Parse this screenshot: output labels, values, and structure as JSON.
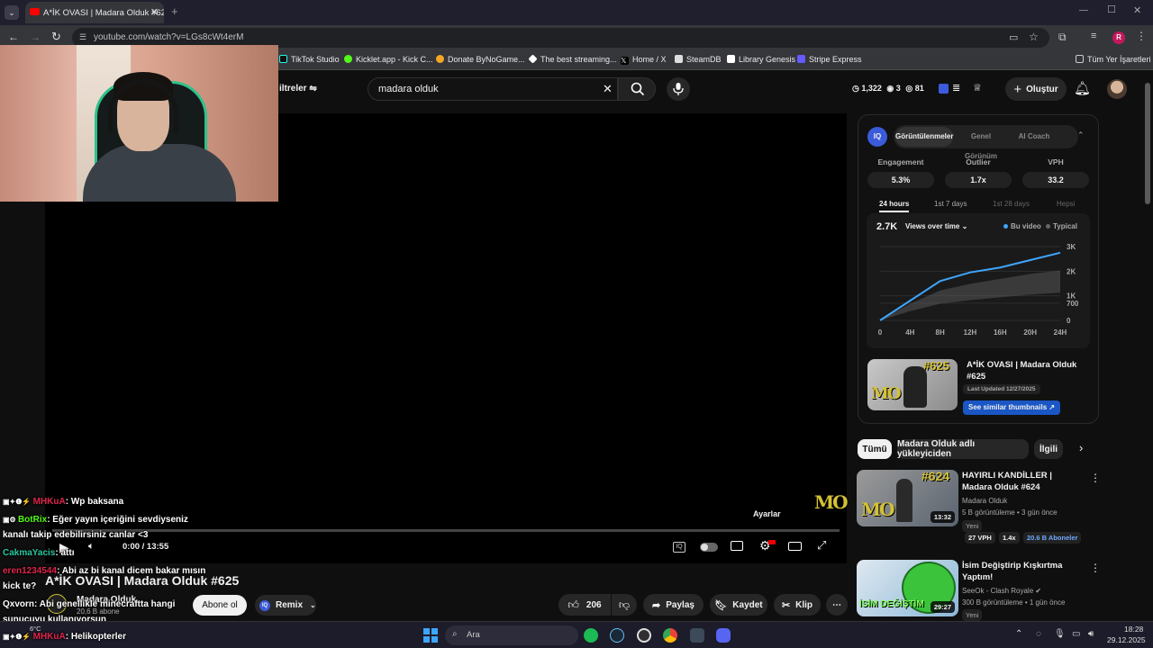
{
  "browser": {
    "tab_title": "A*İK OVASI | Madara Olduk #62",
    "url": "youtube.com/watch?v=LGs8cWt4erM",
    "bookmarks": [
      "TikTok Studio",
      "Kicklet.app - Kick C...",
      "Donate ByNoGame...",
      "The best streaming...",
      "Home / X",
      "SteamDB",
      "Library Genesis",
      "Stripe Express"
    ],
    "all_bookmarks": "Tüm Yer İşaretleri",
    "profile_initial": "R"
  },
  "youtube": {
    "filters_label": "iltreler",
    "search_value": "madara olduk",
    "stats": {
      "a": "1,322",
      "b": "3",
      "c": "81"
    },
    "create_label": "Oluştur"
  },
  "player": {
    "time": "0:00 / 13:55",
    "tooltip": "Ayarlar",
    "watermark": "MO"
  },
  "video": {
    "title": "A*İK OVASI | Madara Olduk #625",
    "channel": "Madara Olduk",
    "subscribers": "20,6 B abone",
    "subscribe_label": "Abone ol",
    "remix_label": "Remix",
    "likes": "206",
    "share_label": "Paylaş",
    "save_label": "Kaydet",
    "clip_label": "Klip"
  },
  "iq_panel": {
    "logo": "IQ",
    "tabs": [
      "Görüntülenmeler",
      "Genel Görünüm",
      "AI Coach"
    ],
    "metrics": [
      {
        "label": "Engagement",
        "value": "5.3%"
      },
      {
        "label": "Outlier",
        "value": "1.7x"
      },
      {
        "label": "VPH",
        "value": "33.2"
      }
    ],
    "time_tabs": [
      "24 hours",
      "1st 7 days",
      "1st 28 days",
      "Hepsi"
    ],
    "views_total": "2.7K",
    "views_selector": "Views over time",
    "legend": [
      "Bu video",
      "Typical"
    ],
    "thumb_title": "A*İK OVASI | Madara Olduk #625",
    "last_updated": "Last Updated 12/27/2025",
    "similar_label": "See similar thumbnails",
    "thumb_overlay": "#625",
    "thumb_logo": "MO"
  },
  "chart_data": {
    "type": "line",
    "x": [
      "0",
      "4H",
      "8H",
      "12H",
      "16H",
      "20H",
      "24H"
    ],
    "series": [
      {
        "name": "Bu video",
        "values": [
          0,
          800,
          1600,
          1950,
          2150,
          2450,
          2750
        ]
      },
      {
        "name": "Typical",
        "values": [
          0,
          500,
          900,
          1100,
          1250,
          1400,
          1500
        ]
      }
    ],
    "y_ticks": [
      "3K",
      "2K",
      "1K",
      "700",
      "0"
    ],
    "ylim": [
      0,
      3000
    ],
    "grid": true,
    "legend": "top-right"
  },
  "chips": [
    "Tümü",
    "Madara Olduk adlı yükleyiciden",
    "İlgili"
  ],
  "recommendations": [
    {
      "title": "HAYIRLI KANDİLLER | Madara Olduk #624",
      "channel": "Madara Olduk",
      "meta": "5 B görüntüleme • 3 gün önce",
      "tag": "Yeni",
      "duration": "13:32",
      "vph": "27 VPH",
      "outlier": "1.4x",
      "subs": "20.6 B Aboneler",
      "overlay": "#624",
      "logo": "MO"
    },
    {
      "title": "İsim Değiştirip Kışkırtma Yaptım!",
      "channel": "SeeOk - Clash Royale",
      "meta": "300 B görüntüleme • 1 gün önce",
      "tag": "Yeni",
      "duration": "29:27",
      "overlay": "İSİM DEĞİŞTİM"
    }
  ],
  "chat": [
    {
      "user": "MHKuA",
      "msg": ": Wp baksana",
      "color": "#e0244a"
    },
    {
      "user": "BotRix",
      "msg": ": Eğer yayın içeriğini sevdiyseniz",
      "color": "#53fc18"
    },
    {
      "user": "",
      "msg": "kanalı takip edebilirsiniz canlar <3",
      "color": "#ffffff"
    },
    {
      "user": "CakmaYacis",
      "msg": ": attı",
      "color": "#27c9a0"
    },
    {
      "user": "eren1234544",
      "msg": ": Abi az bi kanal dicem bakar mısın",
      "color": "#e0244a"
    },
    {
      "user": "",
      "msg": "kick te?",
      "color": "#ffffff"
    },
    {
      "user": "Qxvorn",
      "msg": ": Abi genellikle minecraftta hangi",
      "color": "#ffffff"
    },
    {
      "user": "",
      "msg": "sunucuyu kullanıyorsun",
      "color": "#ffffff"
    },
    {
      "user": "MHKuA",
      "msg": ": Helikopterler",
      "color": "#e0244a"
    }
  ],
  "taskbar": {
    "search": "Ara",
    "weather": "6°C",
    "time": "18:28",
    "date": "29.12.2025"
  }
}
